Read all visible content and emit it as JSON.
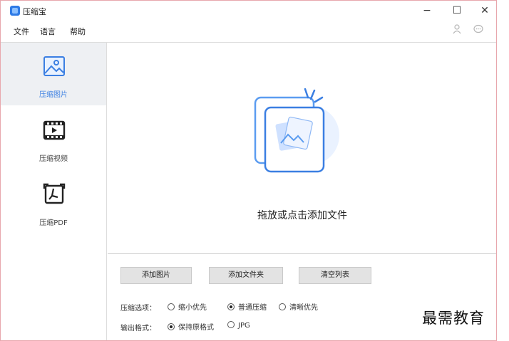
{
  "app": {
    "title": "压缩宝"
  },
  "window_controls": {
    "minimize": "−",
    "maximize": "☐",
    "close": "✕"
  },
  "menu": {
    "file": "文件",
    "language": "语言",
    "help": "帮助"
  },
  "header_icons": {
    "user": "user-icon",
    "chat": "chat-icon"
  },
  "sidebar": {
    "items": [
      {
        "label": "压缩图片",
        "icon": "image-icon",
        "active": true
      },
      {
        "label": "压缩视频",
        "icon": "video-icon",
        "active": false
      },
      {
        "label": "压缩PDF",
        "icon": "pdf-icon",
        "active": false
      }
    ]
  },
  "drop_area": {
    "text": "拖放或点击添加文件"
  },
  "buttons": {
    "add_image": "添加图片",
    "add_folder": "添加文件夹",
    "clear_list": "清空列表"
  },
  "compress_options": {
    "label": "压缩选项：",
    "options": [
      {
        "label": "缩小优先",
        "checked": false
      },
      {
        "label": "普通压缩",
        "checked": true
      },
      {
        "label": "清晰优先",
        "checked": false
      }
    ]
  },
  "output_format": {
    "label": "输出格式：",
    "options": [
      {
        "label": "保持原格式",
        "checked": true
      },
      {
        "label": "JPG",
        "checked": false
      }
    ]
  },
  "watermark": {
    "text": "最需教育"
  },
  "colors": {
    "accent": "#3b7fe2",
    "sidebar_active_bg": "#eef0f3",
    "button_bg": "#e3e3e3"
  }
}
